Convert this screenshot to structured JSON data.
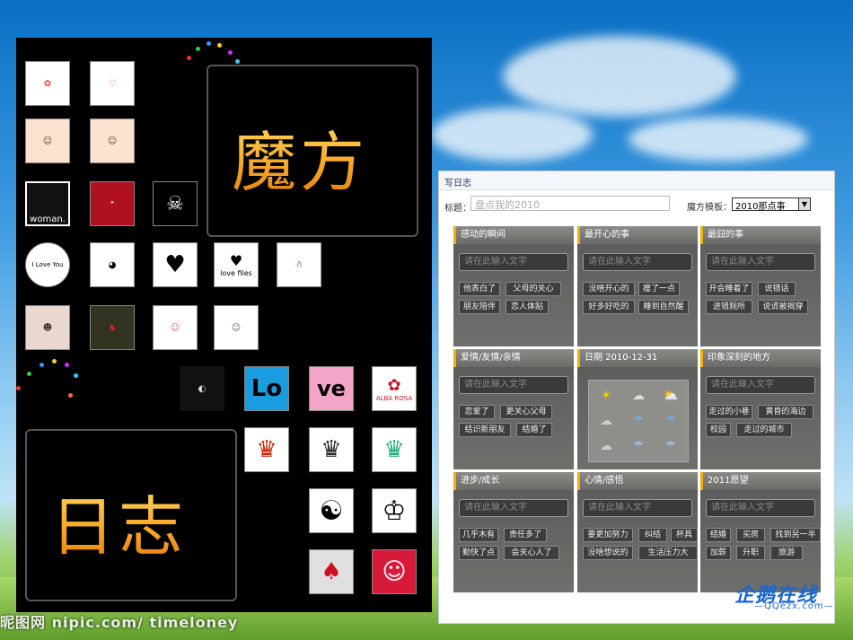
{
  "left_panel": {
    "title_top": "魔方",
    "title_bottom": "日志",
    "thumb_texts": {
      "woman": "woman.",
      "iloveyou": "I Love You",
      "lovefiles": "love files",
      "love_lo": "Lo",
      "love_ve": "ve",
      "alba": "ALBA ROSA"
    }
  },
  "watermark": "昵图网 nipic.com/ timeloney",
  "form": {
    "tab_label": "写日志",
    "title_label": "标题：",
    "title_value": "盘点我的2010",
    "template_label": "魔方模板：",
    "template_value": "2010那点事",
    "input_placeholder": "请在此输入文字",
    "cells": [
      {
        "header": "感动的瞬间",
        "buttons": [
          "他表白了",
          "父母的关心",
          "朋友陪伴",
          "恋人体贴"
        ]
      },
      {
        "header": "最开心的事",
        "buttons": [
          "没啥开心的",
          "瘦了一点",
          "好多好吃的",
          "睡到自然醒"
        ]
      },
      {
        "header": "最囧的事",
        "buttons": [
          "开会睡着了",
          "说错话",
          "进错厕所",
          "说谎被揭穿"
        ]
      },
      {
        "header": "爱情/友情/亲情",
        "buttons": [
          "恋爱了",
          "更关心父母",
          "结识新朋友",
          "结婚了"
        ]
      },
      {
        "header": "日期 2010-12-31",
        "buttons": []
      },
      {
        "header": "印象深刻的地方",
        "buttons": [
          "走过的小巷",
          "黄昏的海边",
          "校园",
          "走过的城市"
        ]
      },
      {
        "header": "进步/成长",
        "buttons": [
          "几乎木有",
          "责任多了",
          "勤快了点",
          "会关心人了"
        ]
      },
      {
        "header": "心情/感悟",
        "buttons": [
          "要更加努力",
          "纠结",
          "杯具",
          "没啥想说的",
          "生活压力大"
        ]
      },
      {
        "header": "2011愿望",
        "buttons": [
          "结婚",
          "买房",
          "找到另一半",
          "加薪",
          "升职",
          "旅游"
        ]
      }
    ]
  },
  "brand": {
    "name": "企鹅在线",
    "sub": "—QQezx.com—"
  },
  "colors": {
    "accent": "#f0b000",
    "panel": "#000000",
    "title_gradient": "#f7a623"
  }
}
